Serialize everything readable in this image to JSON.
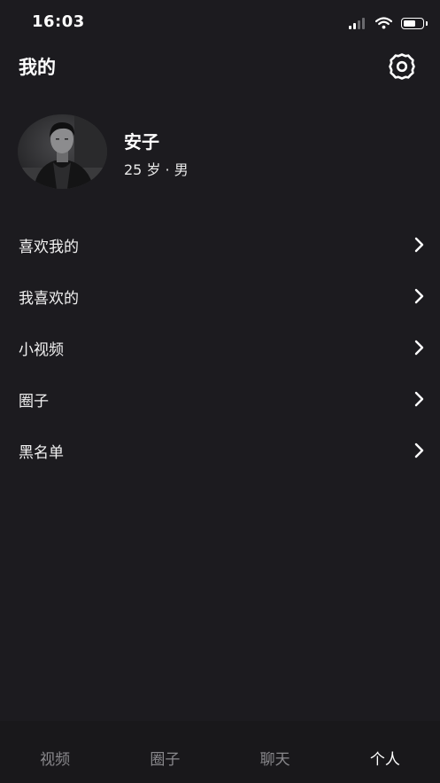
{
  "status_bar": {
    "time": "16:03",
    "signal_icon": "cellular-signal-icon",
    "wifi_icon": "wifi-icon",
    "battery_icon": "battery-icon",
    "battery_level": 0.7
  },
  "header": {
    "title": "我的",
    "settings_icon": "gear-icon"
  },
  "profile": {
    "avatar_icon": "user-avatar",
    "name": "安子",
    "meta": "25 岁 · 男"
  },
  "menu": {
    "items": [
      {
        "label": "喜欢我的",
        "icon": "chevron-right-icon"
      },
      {
        "label": "我喜欢的",
        "icon": "chevron-right-icon"
      },
      {
        "label": "小视频",
        "icon": "chevron-right-icon"
      },
      {
        "label": "圈子",
        "icon": "chevron-right-icon"
      },
      {
        "label": "黑名单",
        "icon": "chevron-right-icon"
      }
    ]
  },
  "tab_bar": {
    "tabs": [
      {
        "label": "视频",
        "active": false
      },
      {
        "label": "圈子",
        "active": false
      },
      {
        "label": "聊天",
        "active": false
      },
      {
        "label": "个人",
        "active": true
      }
    ]
  },
  "colors": {
    "background": "#1c1b1f",
    "tab_bar_background": "#19181b",
    "text_primary": "#ffffff",
    "tab_inactive": "#8a898d"
  }
}
